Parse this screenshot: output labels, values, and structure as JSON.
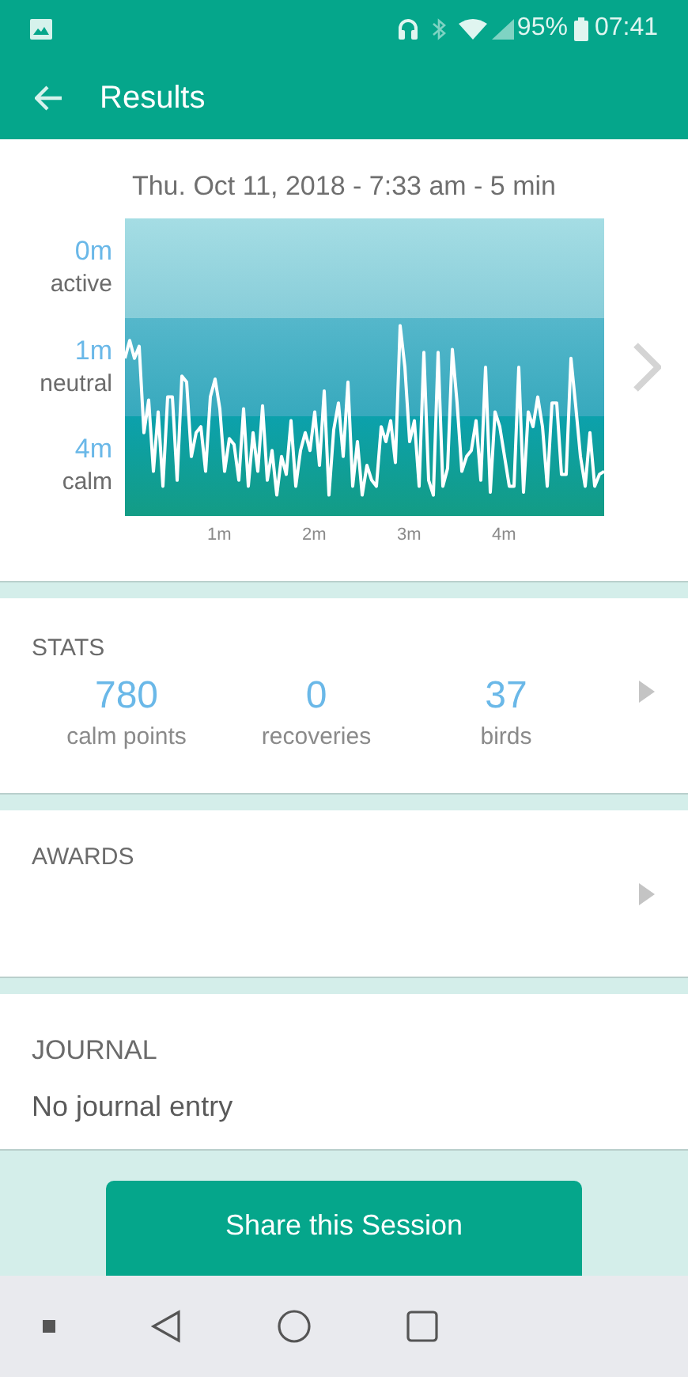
{
  "status_bar": {
    "battery": "95%",
    "time": "07:41"
  },
  "app_bar": {
    "title": "Results"
  },
  "session": {
    "heading": "Thu. Oct 11, 2018 - 7:33 am - 5 min",
    "zones": [
      {
        "minutes": "0m",
        "label": "active"
      },
      {
        "minutes": "1m",
        "label": "neutral"
      },
      {
        "minutes": "4m",
        "label": "calm"
      }
    ],
    "x_labels": [
      "1m",
      "2m",
      "3m",
      "4m"
    ]
  },
  "stats": {
    "title": "STATS",
    "items": [
      {
        "value": "780",
        "label": "calm points"
      },
      {
        "value": "0",
        "label": "recoveries"
      },
      {
        "value": "37",
        "label": "birds"
      }
    ]
  },
  "awards": {
    "title": "AWARDS"
  },
  "journal": {
    "title": "JOURNAL",
    "text": "No journal entry"
  },
  "share_button": "Share this Session"
}
